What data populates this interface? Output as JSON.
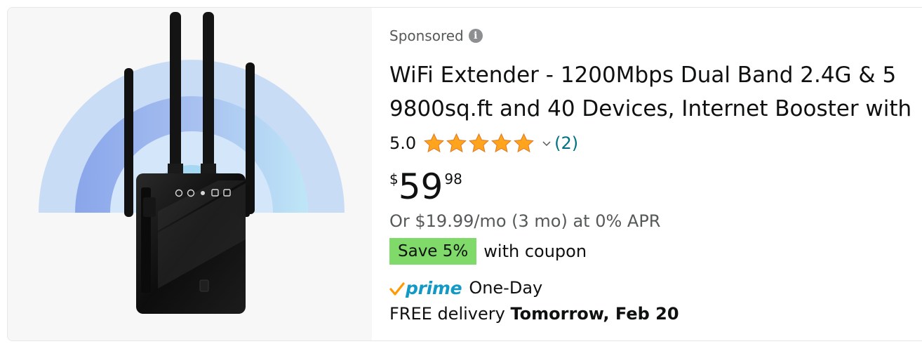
{
  "product": {
    "sponsored_label": "Sponsored",
    "title_line1": "WiFi Extender - 1200Mbps Dual Band 2.4G & 5",
    "title_line2": "9800sq.ft and 40 Devices, Internet Booster with",
    "rating": "5.0",
    "rating_stars": 5,
    "review_count": "(2)",
    "price_symbol": "$",
    "price_whole": "59",
    "price_fraction": "98",
    "financing": "Or $19.99/mo (3 mo) at 0% APR",
    "coupon_badge": "Save 5%",
    "coupon_text": "with coupon",
    "prime_label": "prime",
    "prime_speed": "One-Day",
    "delivery_prefix": "FREE delivery",
    "delivery_date": "Tomorrow, Feb 20"
  },
  "colors": {
    "link": "#007185",
    "star": "#ffa41c",
    "coupon_bg": "#7fda69",
    "prime_blue": "#1399c6",
    "prime_check": "#ff9900"
  },
  "icons": {
    "info": "info-icon",
    "chevron": "chevron-down-icon",
    "prime_check": "checkmark-icon"
  }
}
